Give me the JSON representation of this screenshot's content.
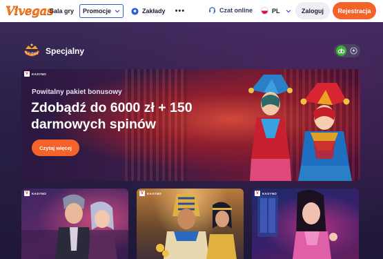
{
  "header": {
    "logo_text": "Vivegas",
    "nav": {
      "sala_gry": "Sala gry",
      "promocje": "Promocje",
      "zaklady": "Zakłady",
      "more": "•••"
    },
    "chat_label": "Czat online",
    "language": "PL",
    "login_label": "Zaloguj",
    "register_label": "Rejestracja"
  },
  "section": {
    "title": "Specjalny"
  },
  "hero": {
    "badge": "KASYNO",
    "subtitle": "Powitalny pakiet bonusowy",
    "title": "Zdobądź do 6000 zł + 150 darmowych spinów",
    "cta_label": "Czytaj więcej"
  },
  "cards": [
    {
      "badge": "KASYNO"
    },
    {
      "badge": "KASYNO"
    },
    {
      "badge": "KASYNO"
    }
  ],
  "colors": {
    "accent_orange": "#f3632a",
    "promo_border": "#2b5fd9",
    "toggle_active": "#3fae3a",
    "background": "#2a2048"
  },
  "icons": {
    "nav_zaklady": "soccer-ball-icon",
    "chat": "headset-icon",
    "language": "poland-flag-icon",
    "toggle_active": "casino-chip-icon",
    "toggle_inactive": "soccer-ball-icon"
  }
}
